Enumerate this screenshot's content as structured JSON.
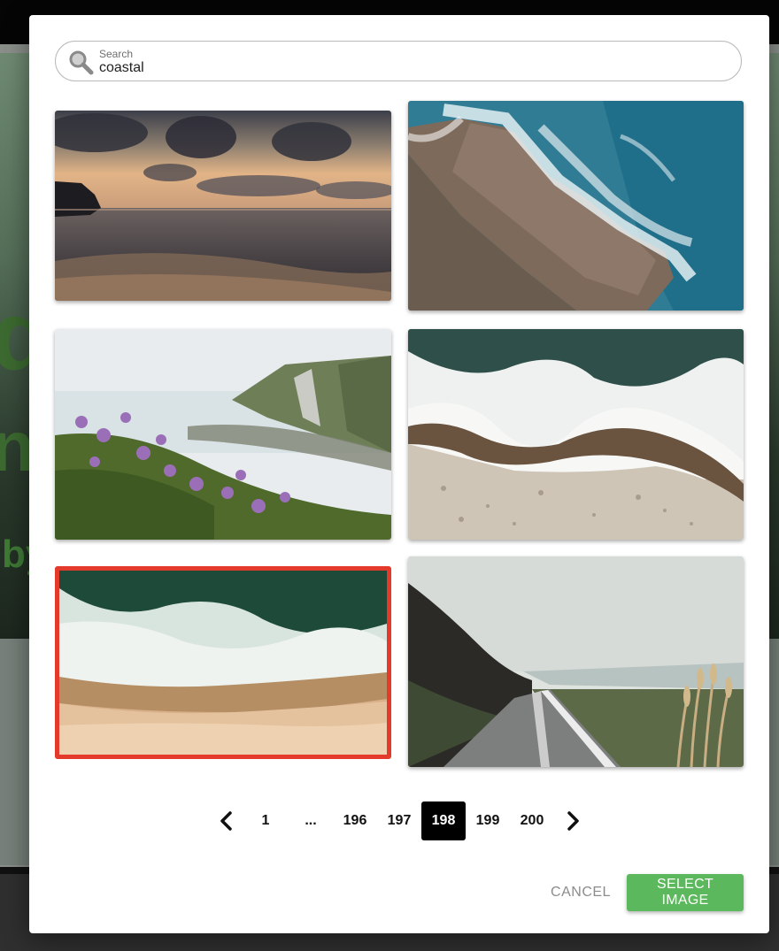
{
  "background_page": {
    "hero_letters": [
      "di",
      "n",
      "by"
    ]
  },
  "search": {
    "label": "Search",
    "value": "coastal",
    "icon": "search-icon"
  },
  "images": [
    {
      "name": "sunset-sea-clouds",
      "selected": false
    },
    {
      "name": "aerial-rocky-coast",
      "selected": false
    },
    {
      "name": "cliffs-purple-flowers",
      "selected": false
    },
    {
      "name": "aerial-waves-shoreline",
      "selected": false
    },
    {
      "name": "aerial-waves-sand-beach",
      "selected": true
    },
    {
      "name": "coastal-road",
      "selected": false
    }
  ],
  "pagination": {
    "prev_icon": "chevron-left-icon",
    "next_icon": "chevron-right-icon",
    "first": "1",
    "ellipsis": "...",
    "pages": [
      "196",
      "197",
      "198",
      "199",
      "200"
    ],
    "current": "198"
  },
  "actions": {
    "cancel_label": "CANCEL",
    "select_label": "SELECT IMAGE"
  },
  "colors": {
    "selected_border": "#e33a2c",
    "select_button": "#5cb85c",
    "current_page_bg": "#000000"
  }
}
